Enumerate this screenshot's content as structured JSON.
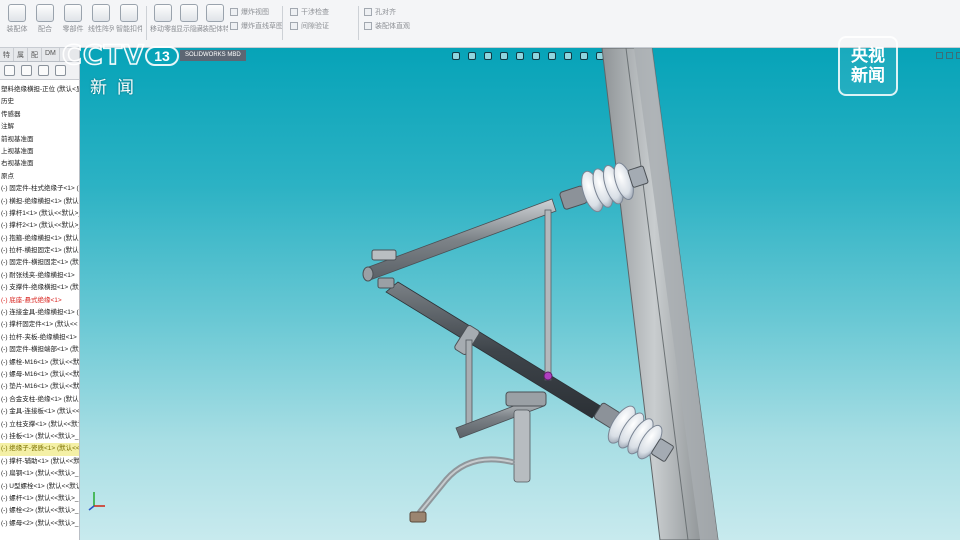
{
  "ribbon": {
    "buttons": [
      {
        "label": "装配体",
        "icon": "insert-components-icon"
      },
      {
        "label": "配合",
        "icon": "mate-icon"
      },
      {
        "label": "零部件",
        "icon": "component-preview-icon"
      },
      {
        "label": "线性阵列",
        "icon": "linear-pattern-icon"
      },
      {
        "label": "智能扣件",
        "icon": "smart-fasteners-icon"
      },
      {
        "label": "移动零部件",
        "icon": "move-component-icon"
      },
      {
        "label": "显示隐藏",
        "icon": "show-hidden-icon"
      },
      {
        "label": "装配体特征",
        "icon": "assembly-features-icon"
      },
      {
        "label": "参考几何",
        "icon": "reference-geometry-icon"
      },
      {
        "label": "新建运动",
        "icon": "new-motion-study-icon"
      },
      {
        "label": "材料明细",
        "icon": "bill-of-materials-icon"
      }
    ],
    "small_tools": [
      "爆炸视图",
      "爆炸直线草图",
      "干涉检查",
      "间隙验证",
      "孔对齐",
      "装配体直观",
      "性能评估",
      "更新"
    ]
  },
  "left_panel": {
    "tabs": [
      "特",
      "属",
      "配",
      "DM"
    ],
    "tree": [
      {
        "text": "塑料绝缘横担-正位 (默认<显"
      },
      {
        "text": "历史"
      },
      {
        "text": "传感器"
      },
      {
        "text": "注解"
      },
      {
        "text": "前视基准面"
      },
      {
        "text": "上视基准面"
      },
      {
        "text": "右视基准面"
      },
      {
        "text": "原点"
      },
      {
        "text": "(-) 固定件-柱式绝缘子<1> (默认"
      },
      {
        "text": "(-) 横担-绝缘横担<1> (默认<<"
      },
      {
        "text": "(-) 撑杆1<1> (默认<<默认>_显"
      },
      {
        "text": "(-) 撑杆2<1> (默认<<默认>_显"
      },
      {
        "text": "(-) 抱箍-绝缘横担<1> (默认"
      },
      {
        "text": "(-) 拉杆-横担固定<1> (默认<"
      },
      {
        "text": "(-) 固定件-横担固定<1> (默认"
      },
      {
        "text": "(-) 耐张线夹-绝缘横担<1>"
      },
      {
        "text": "(-) 支撑件-绝缘横担<1> (默认"
      },
      {
        "text": "(-) 底座-悬式绝缘<1>",
        "style": "red"
      },
      {
        "text": "(-) 连接金具-绝缘横担<1> (默"
      },
      {
        "text": "(-) 撑杆固定件<1> (默认<<"
      },
      {
        "text": "(-) 拉杆-夹板-绝缘横担<1>"
      },
      {
        "text": "(-) 固定件-横担端部<1> (默认"
      },
      {
        "text": "(-) 螺栓-M16<1> (默认<<默认"
      },
      {
        "text": "(-) 螺母-M16<1> (默认<<默"
      },
      {
        "text": "(-) 垫片-M16<1> (默认<<默认"
      },
      {
        "text": "(-) 合金支柱-绝缘<1> (默认"
      },
      {
        "text": "(-) 金具-连接板<1> (默认<<"
      },
      {
        "text": "(-) 立柱支撑<1> (默认<<默认"
      },
      {
        "text": "(-) 挂板<1> (默认<<默认>_"
      },
      {
        "text": "(-) 绝缘子-瓷质<1> (默认<<",
        "style": "sel"
      },
      {
        "text": "(-) 撑杆-辅助<1> (默认<<默认"
      },
      {
        "text": "(-) 扁钢<1> (默认<<默认>_"
      },
      {
        "text": "(-) U型螺栓<1> (默认<<默认"
      },
      {
        "text": "(-) 螺杆<1> (默认<<默认>_"
      },
      {
        "text": "(-) 螺栓<2> (默认<<默认>_"
      },
      {
        "text": "(-) 螺母<2> (默认<<默认>_"
      }
    ]
  },
  "viewport": {
    "tab_label": "SOLIDWORKS MBD",
    "background_top": "#06a3b8",
    "background_bottom": "#c8eaee"
  },
  "overlay": {
    "cctv_logo": "CCTV",
    "channel_number": "13",
    "channel_name": "新闻",
    "news_logo_line1": "央视",
    "news_logo_line2": "新闻"
  }
}
